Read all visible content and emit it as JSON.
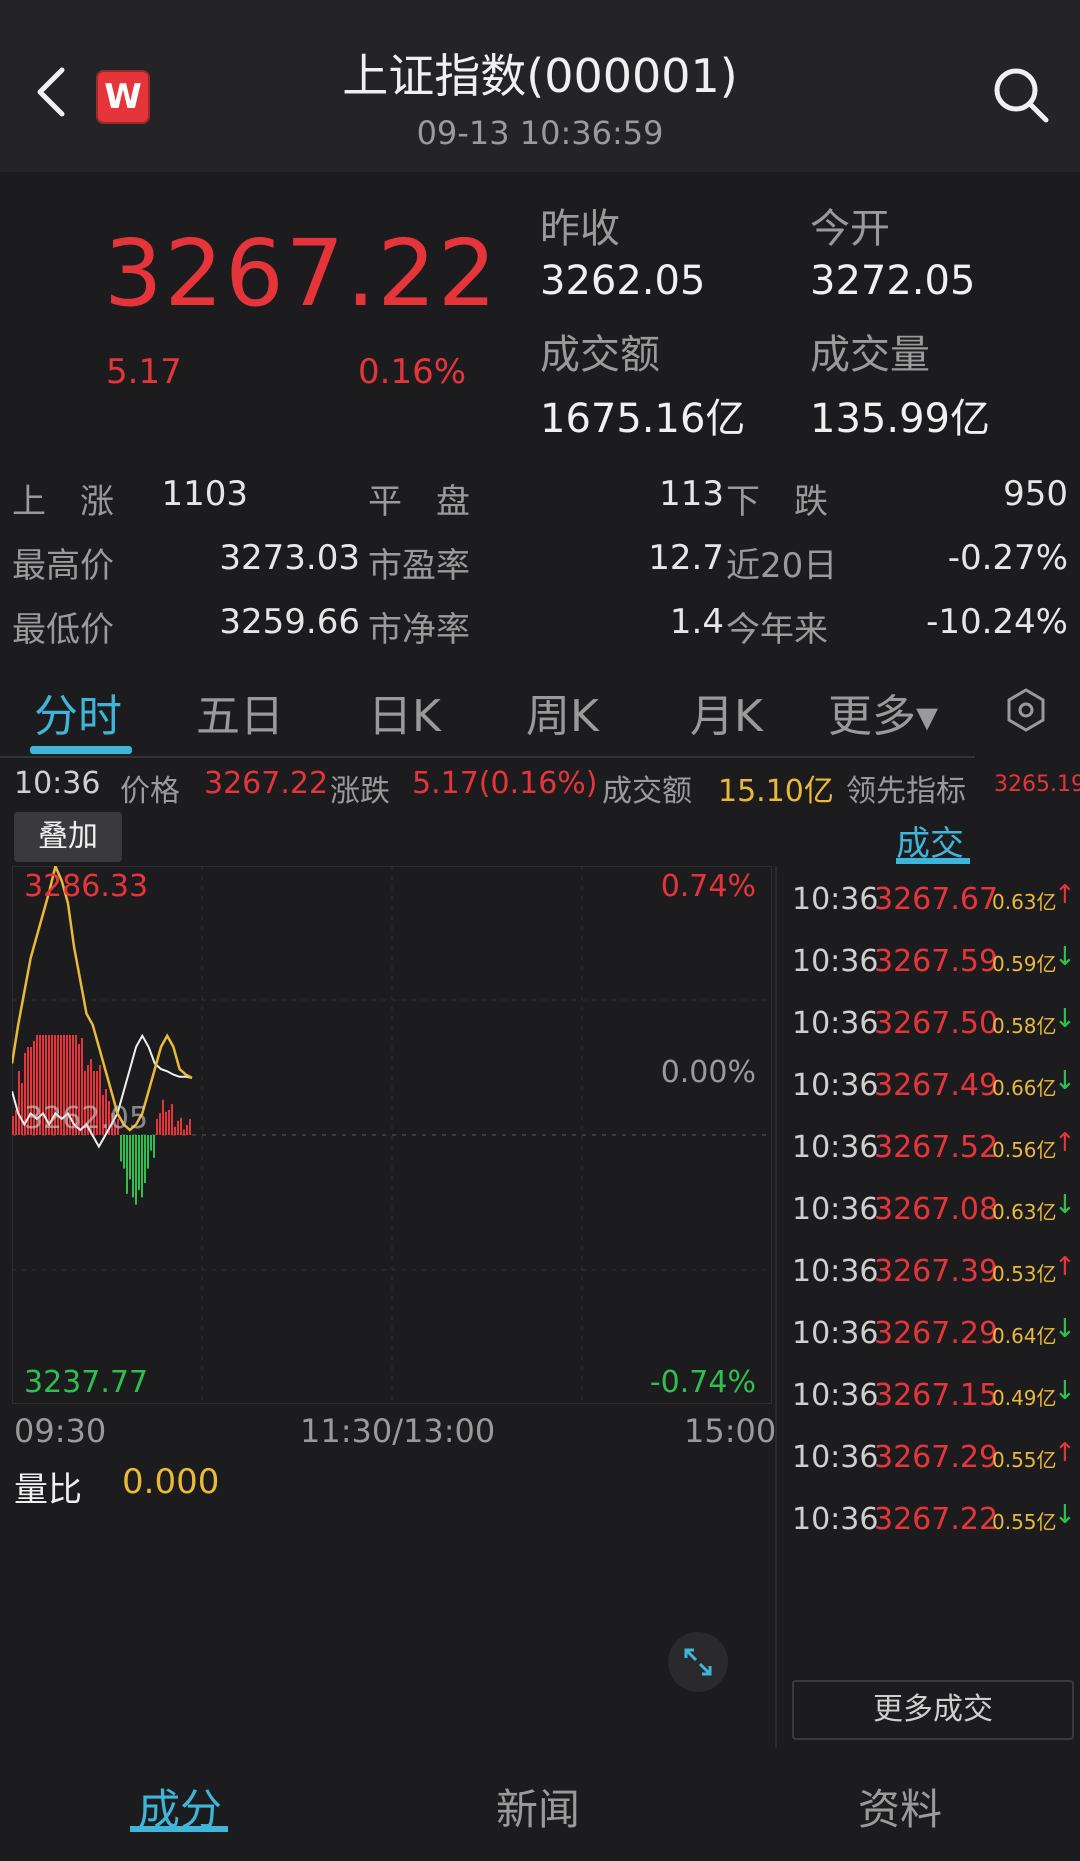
{
  "header": {
    "title": "上证指数(000001)",
    "time": "09-13 10:36:59",
    "logo_text": "W",
    "icons": {
      "back": "chevron-left-icon",
      "search": "search-icon"
    }
  },
  "quote": {
    "price": "3267.22",
    "change": "5.17",
    "change_pct": "0.16%",
    "prev_close_label": "昨收",
    "prev_close": "3262.05",
    "open_label": "今开",
    "open": "3272.05",
    "turnover_label": "成交额",
    "turnover": "1675.16亿",
    "volume_label": "成交量",
    "volume": "135.99亿"
  },
  "stats": {
    "rows": [
      [
        {
          "label": "上　涨",
          "value": "1103"
        },
        {
          "label": "平　盘",
          "value": "113"
        },
        {
          "label": "下　跌",
          "value": "950"
        }
      ],
      [
        {
          "label": "最高价",
          "value": "3273.03"
        },
        {
          "label": "市盈率",
          "value": "12.7"
        },
        {
          "label": "近20日",
          "value": "-0.27%"
        }
      ],
      [
        {
          "label": "最低价",
          "value": "3259.66"
        },
        {
          "label": "市净率",
          "value": "1.4"
        },
        {
          "label": "今年来",
          "value": "-10.24%"
        }
      ]
    ]
  },
  "tabs": [
    "分时",
    "五日",
    "日K",
    "周K",
    "月K",
    "更多▾"
  ],
  "active_tab": 0,
  "settings_icon": "settings-icon",
  "info_line": {
    "time": "10:36",
    "price_label": "价格",
    "price": "3267.22",
    "change_label": "涨跌",
    "change": "5.17(0.16%)",
    "turnover_label": "成交额",
    "turnover": "15.10亿",
    "leader_label": "领先指标",
    "leader": "3265.19"
  },
  "overlay_btn": "叠加",
  "trades_header": "成交",
  "chart_data": {
    "type": "line",
    "y_top": "3286.33",
    "y_mid": "3262.05",
    "y_bottom": "3237.77",
    "pct_top": "0.74%",
    "pct_mid": "0.00%",
    "pct_bottom": "-0.74%",
    "x_labels": [
      "09:30",
      "11:30/13:00",
      "15:00"
    ],
    "ylim": [
      3237.77,
      3286.33
    ],
    "series": [
      {
        "values": [
          3268.5,
          3272,
          3275,
          3278,
          3280,
          3282,
          3284,
          3286.3,
          3285,
          3283,
          3279,
          3276,
          3273,
          3272,
          3270,
          3268,
          3266,
          3264,
          3263,
          3262.5,
          3263,
          3264,
          3266,
          3268,
          3270,
          3271,
          3270,
          3268,
          3267.5,
          3267.2
        ]
      },
      {
        "values": [
          3266,
          3264,
          3263,
          3264,
          3263.5,
          3264,
          3263,
          3264,
          3263.5,
          3264,
          3263,
          3262.5,
          3263,
          3262,
          3261,
          3262,
          3263,
          3264,
          3266,
          3268,
          3270,
          3271,
          3270,
          3268.5,
          3268,
          3267.8,
          3267.5,
          3267.3,
          3267.3,
          3267.2
        ]
      }
    ],
    "colors": {
      "price": "#e9b93a",
      "leader": "#f0f0f0",
      "up_bar": "#e5353a",
      "down_bar": "#2fbf4f"
    }
  },
  "volume_ratio": {
    "label": "量比",
    "value": "0.000"
  },
  "trades": [
    {
      "time": "10:36",
      "price": "3267.67",
      "vol": "0.63亿",
      "dir": "↑",
      "up": true
    },
    {
      "time": "10:36",
      "price": "3267.59",
      "vol": "0.59亿",
      "dir": "↓",
      "up": false
    },
    {
      "time": "10:36",
      "price": "3267.50",
      "vol": "0.58亿",
      "dir": "↓",
      "up": false
    },
    {
      "time": "10:36",
      "price": "3267.49",
      "vol": "0.66亿",
      "dir": "↓",
      "up": false
    },
    {
      "time": "10:36",
      "price": "3267.52",
      "vol": "0.56亿",
      "dir": "↑",
      "up": true
    },
    {
      "time": "10:36",
      "price": "3267.08",
      "vol": "0.63亿",
      "dir": "↓",
      "up": false
    },
    {
      "time": "10:36",
      "price": "3267.39",
      "vol": "0.53亿",
      "dir": "↑",
      "up": true
    },
    {
      "time": "10:36",
      "price": "3267.29",
      "vol": "0.64亿",
      "dir": "↓",
      "up": false
    },
    {
      "time": "10:36",
      "price": "3267.15",
      "vol": "0.49亿",
      "dir": "↓",
      "up": false
    },
    {
      "time": "10:36",
      "price": "3267.29",
      "vol": "0.55亿",
      "dir": "↑",
      "up": true
    },
    {
      "time": "10:36",
      "price": "3267.22",
      "vol": "0.55亿",
      "dir": "↓",
      "up": false
    }
  ],
  "more_trades": "更多成交",
  "expand_icon": "expand-icon",
  "bottom_nav": [
    "成分",
    "新闻",
    "资料"
  ],
  "active_bottom": 0
}
